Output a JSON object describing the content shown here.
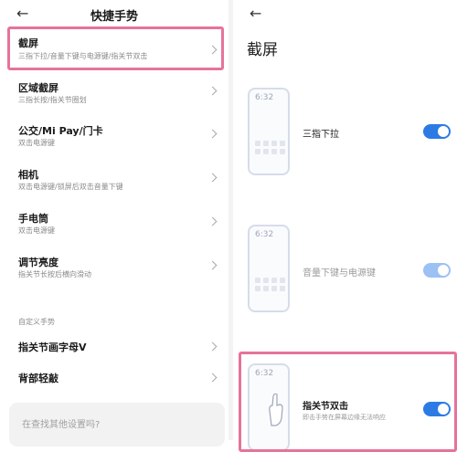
{
  "left": {
    "back_icon": "arrow-left-icon",
    "title": "快捷手势",
    "items": [
      {
        "title": "截屏",
        "subtitle": "三指下拉/音量下键与电源键/指关节双击"
      },
      {
        "title": "区域截屏",
        "subtitle": "三指长按/指关节圈划"
      },
      {
        "title": "公交/Mi Pay/门卡",
        "subtitle": "双击电源键"
      },
      {
        "title": "相机",
        "subtitle": "双击电源键/锁屏后双击音量下键"
      },
      {
        "title": "手电筒",
        "subtitle": "双击电源键"
      },
      {
        "title": "调节亮度",
        "subtitle": "指关节长按后横向滑动"
      }
    ],
    "section_label": "自定义手势",
    "custom_items": [
      {
        "title": "指关节画字母V"
      },
      {
        "title": "背部轻敲"
      }
    ],
    "search_placeholder": "在查找其他设置吗?"
  },
  "right": {
    "back_icon": "arrow-left-icon",
    "title": "截屏",
    "options": [
      {
        "label": "三指下拉",
        "time": "6:32",
        "enabled": true,
        "dimmed": false
      },
      {
        "label": "音量下键与电源键",
        "time": "6:32",
        "enabled": true,
        "dimmed": true
      },
      {
        "label": "指关节双击",
        "sublabel": "即击手势在屏幕边缘无法响应",
        "time": "6:32",
        "enabled": true,
        "dimmed": false
      }
    ]
  },
  "colors": {
    "highlight": "#e6739a",
    "toggle_on": "#2c7be5",
    "toggle_dim": "#9cc1f3"
  }
}
